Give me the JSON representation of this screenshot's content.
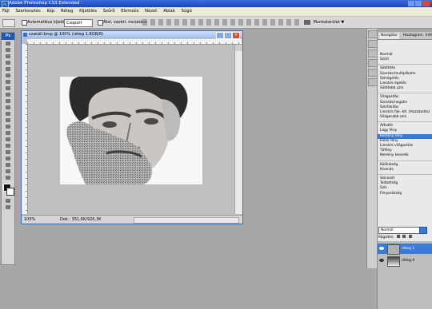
{
  "app": {
    "title": "Adobe Photoshop CS3 Extended",
    "icon": "ps-logo-icon"
  },
  "menu": [
    "Fájl",
    "Szerkesztés",
    "Kép",
    "Réteg",
    "Kijelölés",
    "Szűrő",
    "Elemzés",
    "Nézet",
    "Ablak",
    "Súgó"
  ],
  "options": {
    "auto_select_label": "Automatikus kijelölés:",
    "group_value": "Csoport",
    "transform_label": "Átal. vezérl. mutatása",
    "workspace_label": "Munkaterület"
  },
  "document": {
    "title": "szakáll.bmp @ 100% (réteg 1,RGB/8)",
    "zoom": "100%",
    "doc_info": "Dok.: 351,6K/926,3K"
  },
  "panel": {
    "tabs": [
      "Navigátor",
      "Hisztogram",
      "Infó"
    ],
    "blend_items": [
      "Normál",
      "Szórt",
      "",
      "Sötétítés",
      "Szorzás/multiplikatív",
      "Színégetés",
      "Lineáris égetés",
      "Sötétebb szín",
      "",
      "Világosítás",
      "Szorzás/negatív",
      "Színfakítás",
      "Lineáris fak.-kít. (Hozzáadás)",
      "Világosabb szín",
      "",
      "Átfedés",
      "Lágy fény",
      "Kemény fény",
      "Élénk fény",
      "Lineáris világosítás",
      "Tűfény",
      "Kemény keverék",
      "",
      "Különbség",
      "Kivonás",
      "",
      "Színezet",
      "Telítettség",
      "Szín",
      "Fényerősség"
    ],
    "selected_item": "Kemény fény",
    "blend_value": "Normál",
    "lock_label": "Rögzítés:",
    "layers": [
      {
        "name": "réteg 1",
        "selected": true
      },
      {
        "name": "réteg 0",
        "selected": false
      }
    ]
  },
  "colors": {
    "accent": "#3b7bd8",
    "titlebar": "#1c4fc4"
  }
}
